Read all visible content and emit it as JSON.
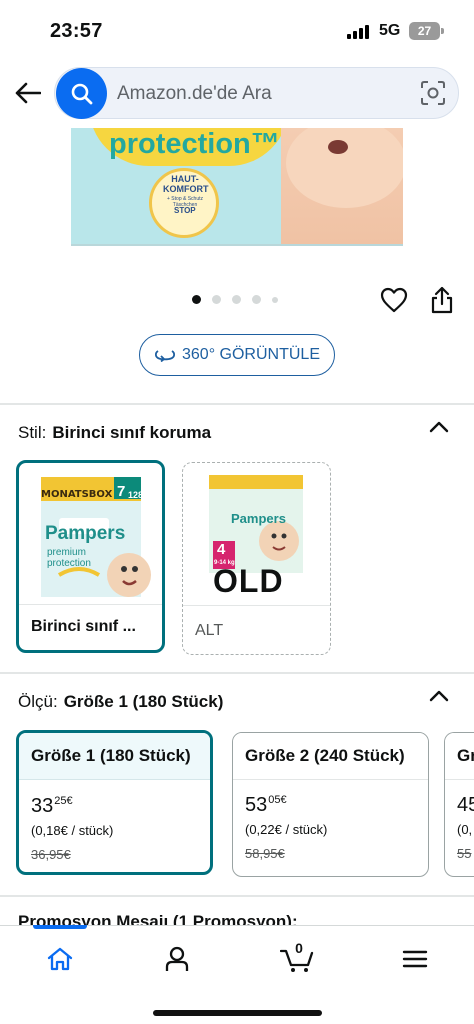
{
  "status_bar": {
    "time": "23:57",
    "network": "5G",
    "battery": "27"
  },
  "header": {
    "back_icon": "arrow-left-icon",
    "search_placeholder": "Amazon.de'de Ara",
    "search_icon": "search-icon",
    "camera_icon": "camera-scan-icon"
  },
  "product_image": {
    "banner_text": "protection™",
    "seal_text": "HAUT-\nKOMFORT",
    "seal_subtext": "+ Stop & Schutz Täschchen",
    "stop_text": "STOP"
  },
  "carousel": {
    "dot_count": 5,
    "active_index": 0,
    "wishlist_icon": "heart-icon",
    "share_icon": "share-icon"
  },
  "view360": {
    "label": "360° GÖRÜNTÜLE",
    "icon": "rotate-360-icon"
  },
  "style_section": {
    "label": "Stil:",
    "selected": "Birinci sınıf koruma",
    "options": [
      {
        "name": "Birinci sınıf ...",
        "selected": true,
        "package_badge": "MONATSBOX",
        "package_brand": "Pampers",
        "package_line": "premium protection",
        "package_size": "7",
        "package_count": "128"
      },
      {
        "name": "ALT",
        "selected": false,
        "overlay_text": "OLD",
        "package_brand": "Pampers",
        "package_size": "4",
        "package_weight": "9-14 kg"
      }
    ]
  },
  "size_section": {
    "label": "Ölçü:",
    "selected": "Größe 1 (180 Stück)",
    "options": [
      {
        "title": "Größe 1 (180 Stück)",
        "price_whole": "33",
        "price_fraction": "25",
        "currency": "€",
        "unit_price": "(0,18€ / stück)",
        "old_price": "36,95€",
        "selected": true
      },
      {
        "title": "Größe 2 (240 Stück)",
        "price_whole": "53",
        "price_fraction": "05",
        "currency": "€",
        "unit_price": "(0,22€ / stück)",
        "old_price": "58,95€",
        "selected": false
      },
      {
        "title": "Gr",
        "price_whole": "45",
        "price_fraction": "",
        "currency": "",
        "unit_price": "(0,",
        "old_price": "55",
        "selected": false
      }
    ]
  },
  "promo_peek": "Promosyon Mesajı (1 Promosyon):",
  "bottom_nav": {
    "items": [
      {
        "icon": "home-icon",
        "active": true
      },
      {
        "icon": "account-icon",
        "active": false
      },
      {
        "icon": "cart-icon",
        "active": false
      },
      {
        "icon": "menu-icon",
        "active": false
      }
    ],
    "cart_count": "0"
  },
  "colors": {
    "accent_blue": "#0a6cf1",
    "selected_teal": "#00707d",
    "link_blue": "#1e5fa0",
    "text": "#0f1111"
  }
}
